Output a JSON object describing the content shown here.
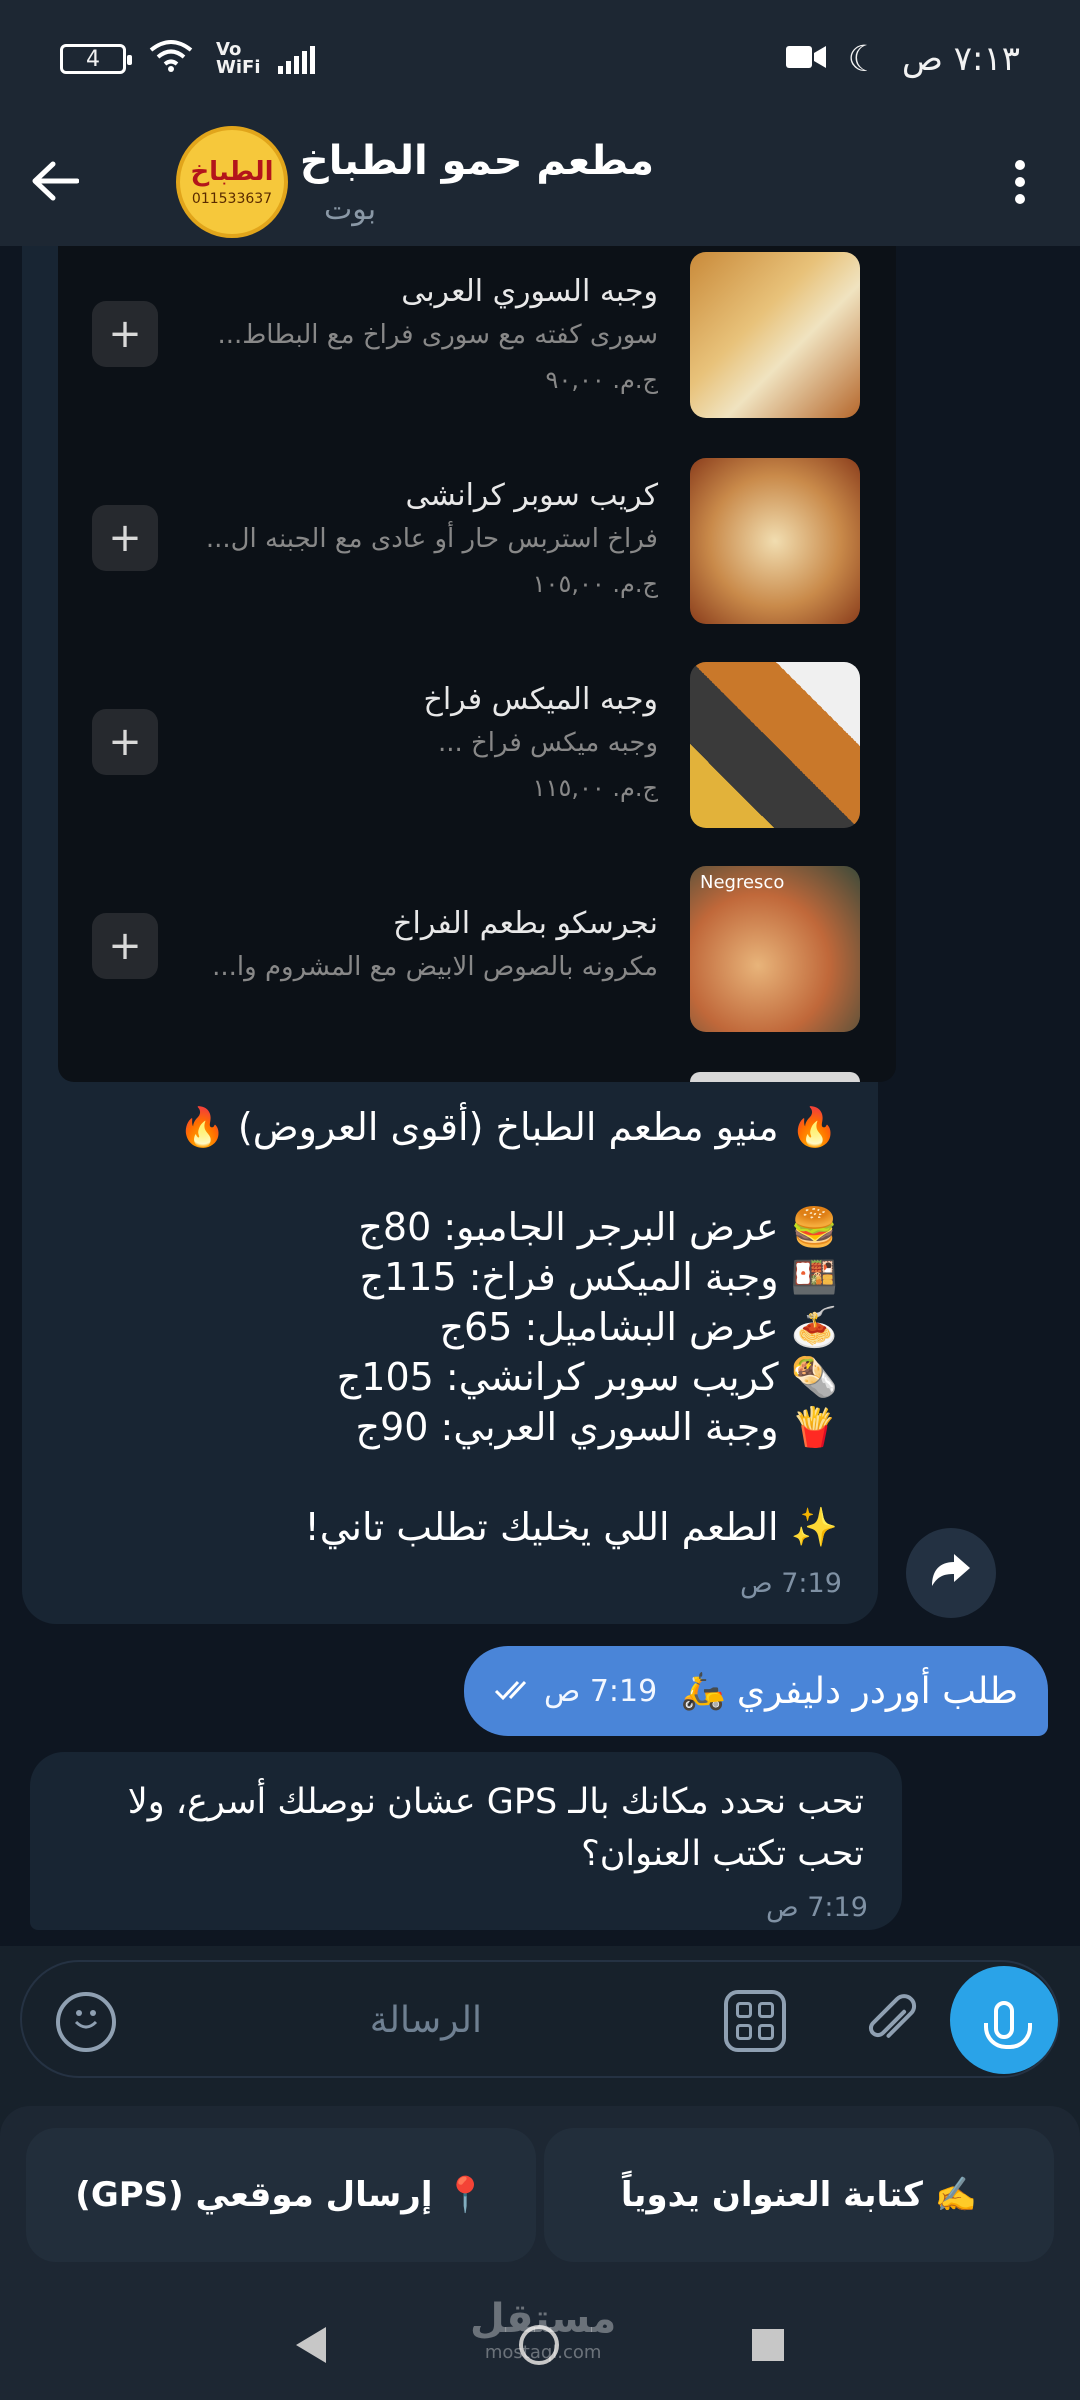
{
  "status_bar": {
    "time": "٧:١٣ ص",
    "battery": "4",
    "vowifi": "Vo WiFi"
  },
  "header": {
    "title": "مطعم حمو الطباخ",
    "subtitle": "بوت",
    "avatar_text": "الطباخ",
    "avatar_phone": "011533637"
  },
  "menu_items": [
    {
      "name": "وجبه السوري العربى",
      "desc": "سورى كفته مع سورى فراخ مع البطاط...",
      "price": "ج.م. ٩٠,٠٠"
    },
    {
      "name": "كريب سوبر كرانشى",
      "desc": "فراخ استربس حار أو عادى مع الجبنه ال...",
      "price": "ج.م. ١٠٥,٠٠"
    },
    {
      "name": "وجبه الميكس فراخ",
      "desc": "وجبه ميكس فراخ ...",
      "price": "ج.م. ١١٥,٠٠"
    },
    {
      "name": "نجرسكو بطعم الفراخ",
      "desc": "مكرونه بالصوص الابيض مع المشروم وا...",
      "price": ""
    }
  ],
  "menu_thumb_label": "Negresco",
  "caption": {
    "line1": "🔥 منيو مطعم الطباخ (أقوى العروض) 🔥",
    "line2": "🍔 عرض البرجر الجامبو: 80ج",
    "line3": "🍱 وجبة الميكس فراخ: 115ج",
    "line4": "🍝 عرض البشاميل: 65ج",
    "line5": "🌯 كريب سوبر كرانشي: 105ج",
    "line6": "🍟 وجبة السوري العربي: 90ج",
    "line7": "✨ الطعم اللي يخليك تطلب تاني!"
  },
  "msg1_time": "7:19 ص",
  "outgoing": {
    "text": "طلب أوردر دليفري 🛵",
    "time": "7:19 ص"
  },
  "incoming": {
    "text": "تحب نحدد مكانك بالـ GPS عشان نوصلك أسرع، ولا تحب تكتب العنوان؟",
    "time": "7:19 ص"
  },
  "input": {
    "placeholder": "الرسالة"
  },
  "keyboard": {
    "location_btn": "📍 إرسال موقعي (GPS)",
    "manual_btn": "✍️ كتابة العنوان يدوياً"
  },
  "watermark": {
    "line1": "مستقل",
    "line2": "mostaql.com"
  },
  "colors": {
    "accent": "#2aa3e8",
    "outgoing_bubble": "#4a85d8",
    "incoming_bubble": "#182533"
  },
  "icons": [
    "back-arrow-icon",
    "more-vert-icon",
    "share-icon",
    "emoji-icon",
    "apps-icon",
    "paperclip-icon",
    "microphone-icon"
  ]
}
